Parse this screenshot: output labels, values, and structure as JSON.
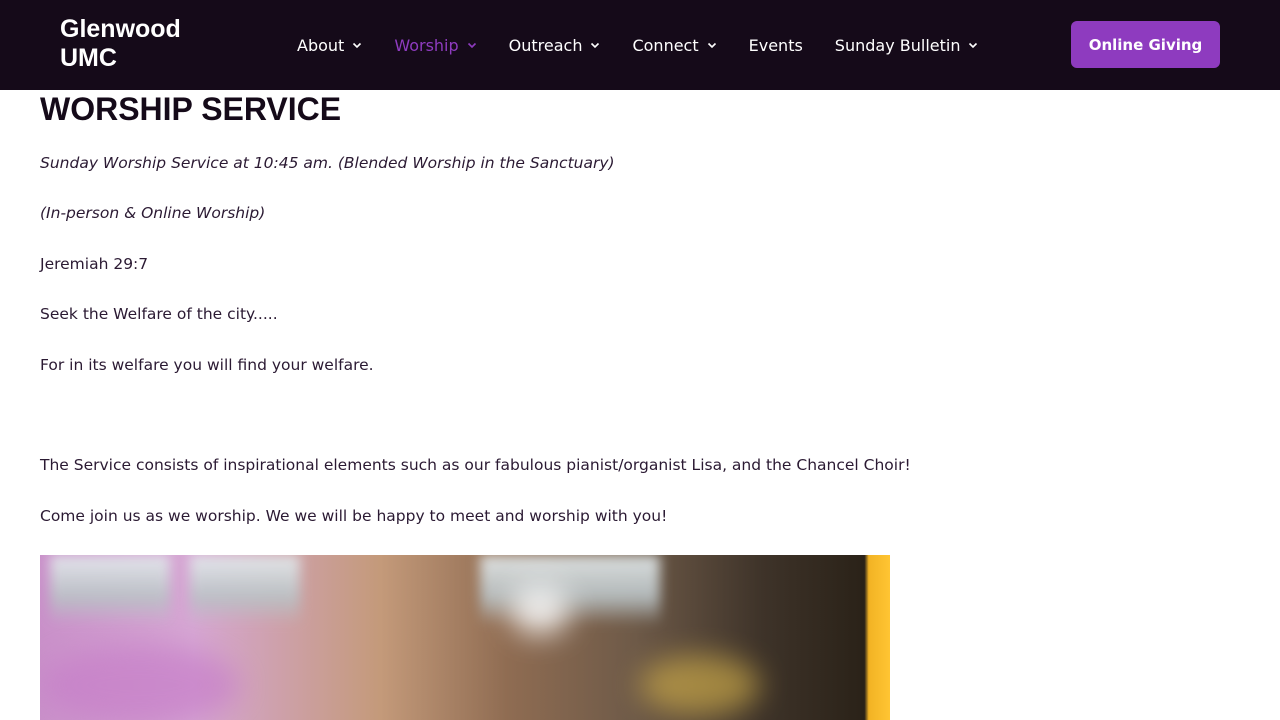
{
  "header": {
    "logo": "Glenwood UMC",
    "nav": [
      {
        "label": "About",
        "has_dropdown": true,
        "active": false
      },
      {
        "label": "Worship",
        "has_dropdown": true,
        "active": true
      },
      {
        "label": "Outreach",
        "has_dropdown": true,
        "active": false
      },
      {
        "label": "Connect",
        "has_dropdown": true,
        "active": false
      },
      {
        "label": "Events",
        "has_dropdown": false,
        "active": false
      },
      {
        "label": "Sunday Bulletin",
        "has_dropdown": true,
        "active": false
      }
    ],
    "cta_label": "Online Giving"
  },
  "main": {
    "title": "WORSHIP SERVICE",
    "paragraphs": [
      {
        "text": "Sunday Worship Service at 10:45 am. (Blended Worship in the Sanctuary)",
        "italic": true
      },
      {
        "text": "(In-person & Online Worship)",
        "italic": true
      },
      {
        "text": "Jeremiah 29:7",
        "italic": false
      },
      {
        "text": "Seek the Welfare of the city.....",
        "italic": false
      },
      {
        "text": "For in its welfare you will find your welfare.",
        "italic": false
      },
      {
        "text": "The Service consists of inspirational elements such as our fabulous pianist/organist Lisa, and the Chancel Choir!",
        "italic": false
      },
      {
        "text": "Come join us as we worship. We we will be happy to meet and worship with you!",
        "italic": false
      }
    ]
  },
  "colors": {
    "header_bg": "#150a19",
    "accent": "#8e3bbf",
    "text": "#2b1a33"
  },
  "icons": {
    "dropdown": "chevron-down-icon"
  }
}
